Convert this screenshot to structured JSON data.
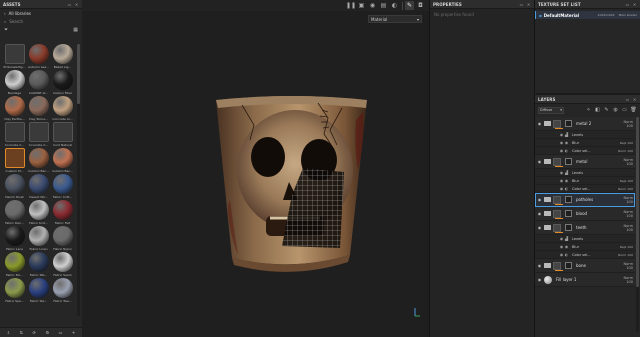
{
  "assets": {
    "title": "ASSETS",
    "nav_label": "All libraries",
    "search_placeholder": "Search",
    "items": [
      {
        "name": "Emboss&Hig...",
        "icon": "square",
        "color": "#888888"
      },
      {
        "name": "Autumn Lea...",
        "icon": "ball",
        "color": "#8a3a2a"
      },
      {
        "name": "Baked Lig...",
        "icon": "ball",
        "color": "#b9aa98"
      },
      {
        "name": "Bandage",
        "icon": "ball",
        "color": "#cfcfcf"
      },
      {
        "name": "CAGMRT st...",
        "icon": "ball",
        "color": "#5a5a5a"
      },
      {
        "name": "Carbon Fiber",
        "icon": "ball",
        "color": "#1a1a1a"
      },
      {
        "name": "Clay Earthe...",
        "icon": "ball",
        "color": "#b06a48"
      },
      {
        "name": "Clay Stone...",
        "icon": "ball",
        "color": "#8a6a5a"
      },
      {
        "name": "Concrete Ai...",
        "icon": "ball",
        "color": "#c0a080"
      },
      {
        "name": "Concrete C...",
        "icon": "square",
        "color": "#888888"
      },
      {
        "name": "Concrete C...",
        "icon": "square",
        "color": "#888888"
      },
      {
        "name": "Cord Natural",
        "icon": "square",
        "color": "#888888"
      },
      {
        "name": "Custom M...",
        "icon": "square",
        "color": "#e08a2a"
      },
      {
        "name": "Custom Bac...",
        "icon": "ball",
        "color": "#9a6040"
      },
      {
        "name": "Custom Bac...",
        "icon": "ball",
        "color": "#c07050"
      },
      {
        "name": "Denim Rivet",
        "icon": "ball",
        "color": "#4a5260"
      },
      {
        "name": "Desert Wil...",
        "icon": "ball",
        "color": "#3a4a70"
      },
      {
        "name": "Fabric Cott...",
        "icon": "ball",
        "color": "#3a5a90"
      },
      {
        "name": "Fabric Den...",
        "icon": "ball",
        "color": "#6a6a6a"
      },
      {
        "name": "Fabric Knit...",
        "icon": "ball",
        "color": "#c0c0c0"
      },
      {
        "name": "Fabric Felt",
        "icon": "ball",
        "color": "#8a2a30"
      },
      {
        "name": "Fabric Lace",
        "icon": "ball",
        "color": "#1a1a1a"
      },
      {
        "name": "Fabric Linen",
        "icon": "ball",
        "color": "#b0b0b0"
      },
      {
        "name": "Fabric Nylon",
        "icon": "ball",
        "color": "#6a6a6a"
      },
      {
        "name": "Fabric Pol...",
        "icon": "ball",
        "color": "#8a9a2a"
      },
      {
        "name": "Fabric Rib...",
        "icon": "ball",
        "color": "#2a3a5a"
      },
      {
        "name": "Fabric Seam",
        "icon": "ball",
        "color": "#d0d0d0"
      },
      {
        "name": "Fabric Spa...",
        "icon": "ball",
        "color": "#8a9a4a"
      },
      {
        "name": "Fabric Tex...",
        "icon": "ball",
        "color": "#2a4080"
      },
      {
        "name": "Fabric Twe...",
        "icon": "ball",
        "color": "#9aa0b0"
      }
    ]
  },
  "viewport": {
    "material_select": "Material"
  },
  "properties": {
    "title": "PROPERTIES",
    "placeholder": "No properties found"
  },
  "texture_set_list": {
    "title": "TEXTURE SET LIST",
    "row": {
      "name": "DefaultMaterial",
      "resolution": "1024x1024",
      "shader": "Main shader"
    }
  },
  "layers": {
    "title": "LAYERS",
    "channel": "Diffuse",
    "rows": [
      {
        "type": "folder",
        "name": "metal 2",
        "blend": "Norm",
        "opacity": "100"
      },
      {
        "type": "sub",
        "icon": "levels-icon",
        "name": "Levels",
        "blend": ""
      },
      {
        "type": "sub",
        "icon": "blur-icon",
        "name": "Blur",
        "blend": "Repl  100"
      },
      {
        "type": "sub",
        "icon": "color-icon",
        "name": "Color sel...",
        "blend": "Norm  100"
      },
      {
        "type": "folder",
        "name": "metal",
        "blend": "Norm",
        "opacity": "100"
      },
      {
        "type": "sub",
        "icon": "levels-icon",
        "name": "Levels",
        "blend": ""
      },
      {
        "type": "sub",
        "icon": "blur-icon",
        "name": "Blur",
        "blend": "Repl  100"
      },
      {
        "type": "sub",
        "icon": "color-icon",
        "name": "Color sel...",
        "blend": "Norm  100"
      },
      {
        "type": "folder",
        "name": "potholes",
        "blend": "Norm",
        "opacity": "100",
        "selected": true
      },
      {
        "type": "folder",
        "name": "blood",
        "blend": "Norm",
        "opacity": "100"
      },
      {
        "type": "folder",
        "name": "teeth",
        "blend": "Norm",
        "opacity": "100"
      },
      {
        "type": "sub",
        "icon": "levels-icon",
        "name": "Levels",
        "blend": ""
      },
      {
        "type": "sub",
        "icon": "blur-icon",
        "name": "Blur",
        "blend": "Repl  100"
      },
      {
        "type": "sub",
        "icon": "color-icon",
        "name": "Color sel...",
        "blend": "Norm  100"
      },
      {
        "type": "folder",
        "name": "bone",
        "blend": "Norm",
        "opacity": "100"
      },
      {
        "type": "fill",
        "name": "Fill layer 1",
        "blend": "Norm",
        "opacity": "100"
      }
    ]
  }
}
